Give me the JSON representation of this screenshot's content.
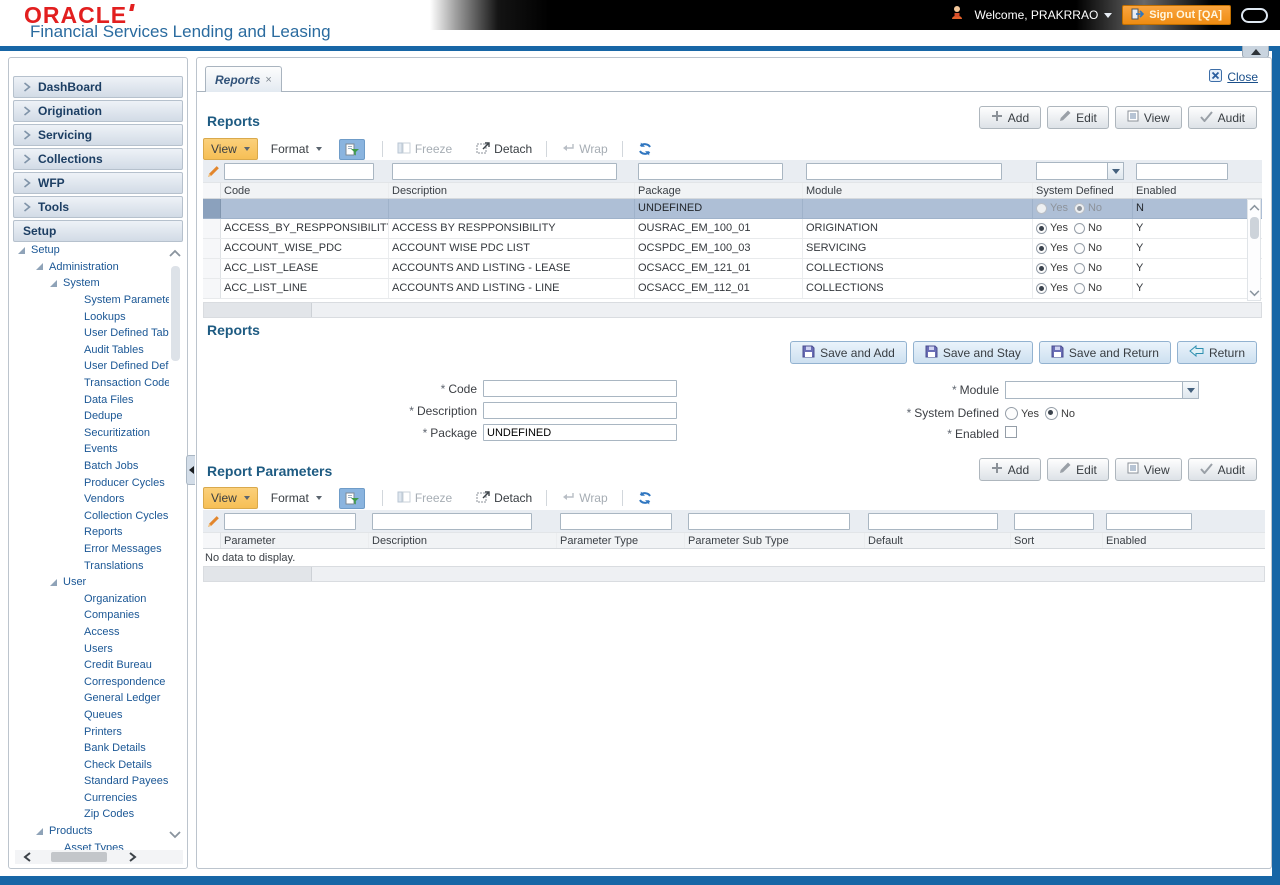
{
  "header": {
    "brand": "ORACLE",
    "subtitle": "Financial Services Lending and Leasing",
    "welcome_label": "Welcome, PRAKRRAO",
    "signout_label": "Sign Out [QA]"
  },
  "sidebar": {
    "accordion": [
      "DashBoard",
      "Origination",
      "Servicing",
      "Collections",
      "WFP",
      "Tools"
    ],
    "setup_header": "Setup",
    "tree": [
      "Setup",
      "Administration",
      "System",
      "System Paramete",
      "Lookups",
      "User Defined Tab",
      "Audit Tables",
      "User Defined Def",
      "Transaction Code",
      "Data Files",
      "Dedupe",
      "Securitization",
      "Events",
      "Batch Jobs",
      "Producer Cycles",
      "Vendors",
      "Collection Cycles",
      "Reports",
      "Error Messages",
      "Translations",
      "User",
      "Organization",
      "Companies",
      "Access",
      "Users",
      "Credit Bureau",
      "Correspondence",
      "General Ledger",
      "Queues",
      "Printers",
      "Bank Details",
      "Check Details",
      "Standard Payees",
      "Currencies",
      "Zip Codes",
      "Products",
      "Asset Types"
    ]
  },
  "tab": {
    "label": "Reports",
    "close_glyph": "×"
  },
  "close_button": "Close",
  "actions": {
    "add": "Add",
    "edit": "Edit",
    "view": "View",
    "audit": "Audit"
  },
  "toolbar": {
    "view": "View",
    "format": "Format",
    "freeze": "Freeze",
    "detach": "Detach",
    "wrap": "Wrap"
  },
  "reports_grid": {
    "title": "Reports",
    "columns": [
      "Code",
      "Description",
      "Package",
      "Module",
      "System Defined",
      "Enabled"
    ],
    "radio_yes": "Yes",
    "radio_no": "No",
    "selected_row": {
      "code": "",
      "description": "",
      "package": "UNDEFINED",
      "module": "",
      "system_defined": "No",
      "enabled": "N"
    },
    "rows": [
      {
        "code": "ACCESS_BY_RESPPONSIBILITY",
        "description": "ACCESS BY RESPPONSIBILITY",
        "package": "OUSRAC_EM_100_01",
        "module": "ORIGINATION",
        "system_defined": "Yes",
        "enabled": "Y"
      },
      {
        "code": "ACCOUNT_WISE_PDC",
        "description": "ACCOUNT WISE PDC LIST",
        "package": "OCSPDC_EM_100_03",
        "module": "SERVICING",
        "system_defined": "Yes",
        "enabled": "Y"
      },
      {
        "code": "ACC_LIST_LEASE",
        "description": "ACCOUNTS AND LISTING - LEASE",
        "package": "OCSACC_EM_121_01",
        "module": "COLLECTIONS",
        "system_defined": "Yes",
        "enabled": "Y"
      },
      {
        "code": "ACC_LIST_LINE",
        "description": "ACCOUNTS AND LISTING - LINE",
        "package": "OCSACC_EM_112_01",
        "module": "COLLECTIONS",
        "system_defined": "Yes",
        "enabled": "Y"
      }
    ]
  },
  "reports_form": {
    "title": "Reports",
    "required_marker": "*",
    "save_add": "Save and Add",
    "save_stay": "Save and Stay",
    "save_return": "Save and Return",
    "return": "Return",
    "code_label": "Code",
    "code_value": "",
    "description_label": "Description",
    "description_value": "",
    "package_label": "Package",
    "package_value": "UNDEFINED",
    "module_label": "Module",
    "module_value": "",
    "system_defined_label": "System Defined",
    "system_defined_value": "No",
    "enabled_label": "Enabled",
    "yes": "Yes",
    "no": "No"
  },
  "report_parameters": {
    "title": "Report Parameters",
    "columns": [
      "Parameter",
      "Description",
      "Parameter Type",
      "Parameter Sub Type",
      "Default",
      "Sort",
      "Enabled"
    ],
    "empty_message": "No data to display."
  }
}
